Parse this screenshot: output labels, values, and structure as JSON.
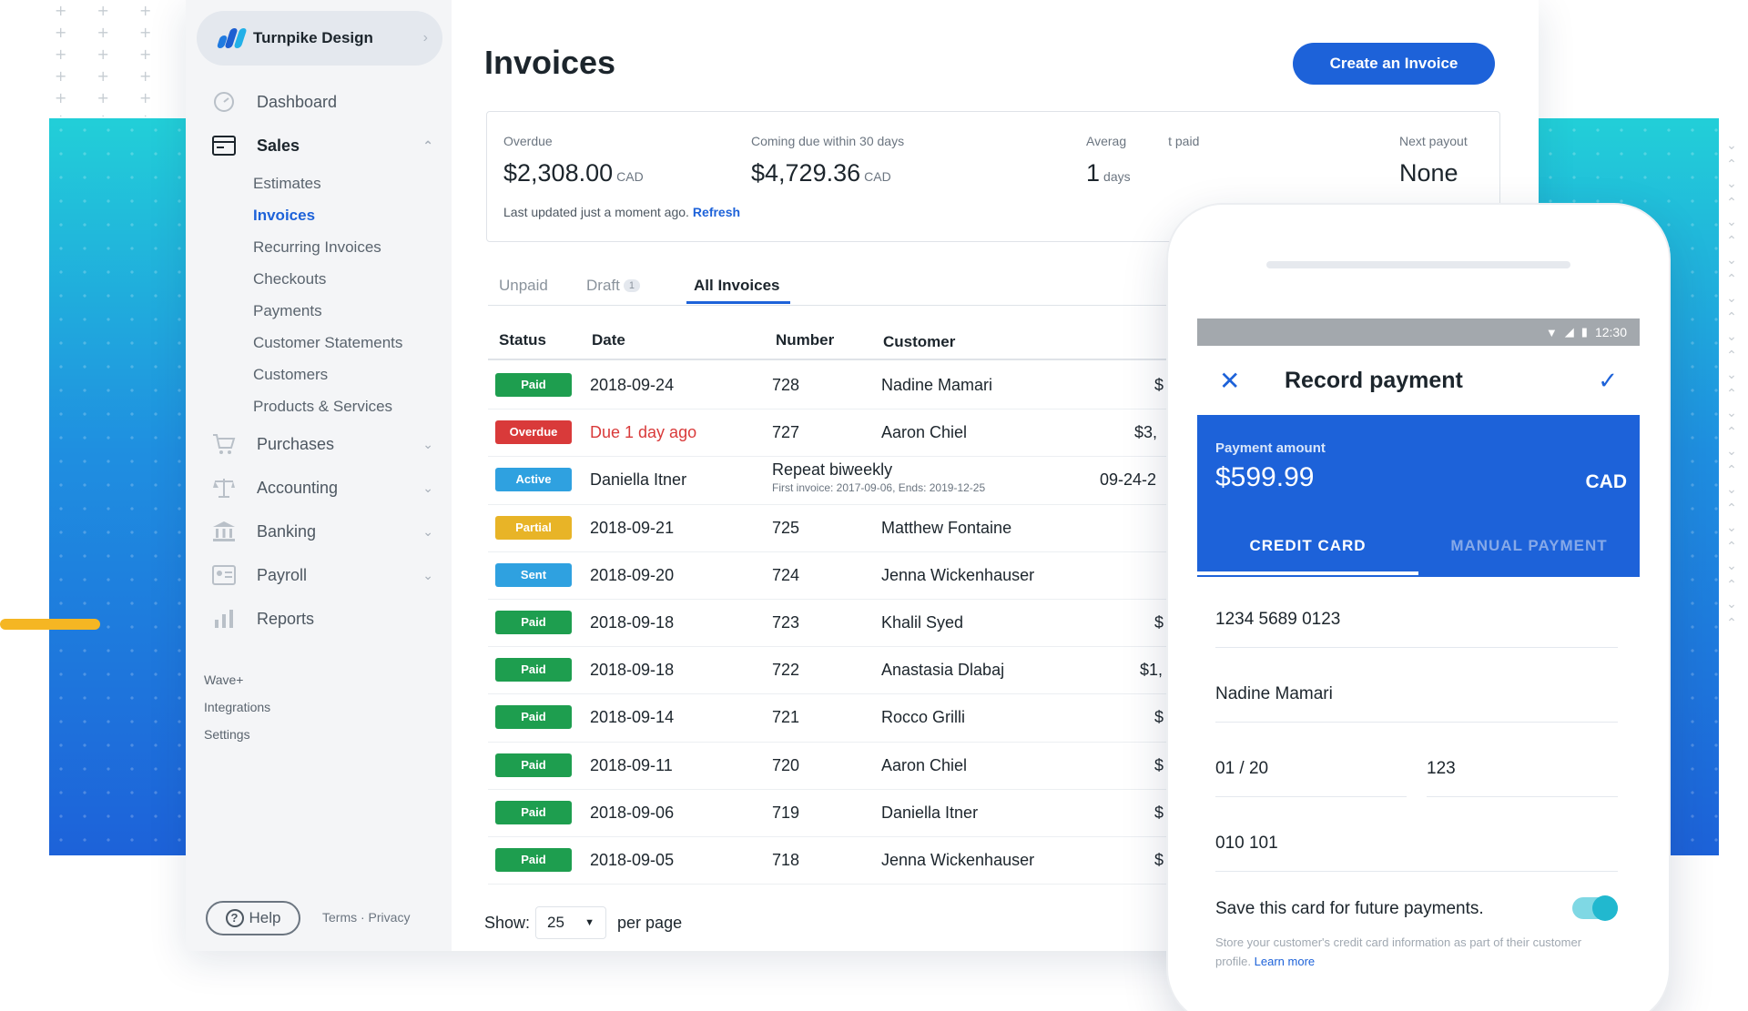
{
  "brand": {
    "name": "Turnpike Design"
  },
  "nav": [
    {
      "label": "Dashboard"
    },
    {
      "label": "Sales"
    },
    {
      "label": "Purchases"
    },
    {
      "label": "Accounting"
    },
    {
      "label": "Banking"
    },
    {
      "label": "Payroll"
    },
    {
      "label": "Reports"
    }
  ],
  "sales_sub": [
    {
      "label": "Estimates"
    },
    {
      "label": "Invoices"
    },
    {
      "label": "Recurring Invoices"
    },
    {
      "label": "Checkouts"
    },
    {
      "label": "Payments"
    },
    {
      "label": "Customer Statements"
    },
    {
      "label": "Customers"
    },
    {
      "label": "Products & Services"
    }
  ],
  "extra_links": [
    "Wave+",
    "Integrations",
    "Settings"
  ],
  "footer": {
    "help": "Help",
    "terms": "Terms · Privacy"
  },
  "page": {
    "title": "Invoices",
    "create_label": "Create an Invoice"
  },
  "summary": {
    "overdue_label": "Overdue",
    "overdue_value": "$2,308.00",
    "overdue_cur": "CAD",
    "coming_label": "Coming due within 30 days",
    "coming_value": "$4,729.36",
    "coming_cur": "CAD",
    "avg_label": "Averag",
    "avg_value": "1",
    "avg_unit": "days",
    "paid_label": "t paid",
    "next_label": "Next payout",
    "next_value": "None",
    "updated": "Last updated just a moment ago.",
    "refresh": "Refresh"
  },
  "tabs": {
    "unpaid": "Unpaid",
    "draft": "Draft",
    "draft_count": "1",
    "all": "All Invoices"
  },
  "columns": {
    "status": "Status",
    "date": "Date",
    "number": "Number",
    "customer": "Customer"
  },
  "rows": [
    {
      "status": "Paid",
      "color": "#1e9e4f",
      "date": "2018-09-24",
      "number": "728",
      "customer": "Nadine Mamari",
      "amount": "$"
    },
    {
      "status": "Overdue",
      "color": "#d93a3a",
      "date": "Due 1 day ago",
      "number": "727",
      "customer": "Aaron Chiel",
      "amount": "$3,",
      "due": true
    },
    {
      "status": "Active",
      "color": "#2fa1e0",
      "date": "Daniella Itner",
      "number": "Repeat biweekly",
      "number_sub": "First invoice: 2017-09-06, Ends: 2019-12-25",
      "customer": "",
      "amount": "09-24-2"
    },
    {
      "status": "Partial",
      "color": "#e8b427",
      "date": "2018-09-21",
      "number": "725",
      "customer": "Matthew Fontaine",
      "amount": ""
    },
    {
      "status": "Sent",
      "color": "#2fa1e0",
      "date": "2018-09-20",
      "number": "724",
      "customer": "Jenna Wickenhauser",
      "amount": ""
    },
    {
      "status": "Paid",
      "color": "#1e9e4f",
      "date": "2018-09-18",
      "number": "723",
      "customer": "Khalil Syed",
      "amount": "$"
    },
    {
      "status": "Paid",
      "color": "#1e9e4f",
      "date": "2018-09-18",
      "number": "722",
      "customer": "Anastasia Dlabaj",
      "amount": "$1,"
    },
    {
      "status": "Paid",
      "color": "#1e9e4f",
      "date": "2018-09-14",
      "number": "721",
      "customer": "Rocco Grilli",
      "amount": "$"
    },
    {
      "status": "Paid",
      "color": "#1e9e4f",
      "date": "2018-09-11",
      "number": "720",
      "customer": "Aaron Chiel",
      "amount": "$"
    },
    {
      "status": "Paid",
      "color": "#1e9e4f",
      "date": "2018-09-06",
      "number": "719",
      "customer": "Daniella Itner",
      "amount": "$"
    },
    {
      "status": "Paid",
      "color": "#1e9e4f",
      "date": "2018-09-05",
      "number": "718",
      "customer": "Jenna Wickenhauser",
      "amount": "$"
    }
  ],
  "pager": {
    "show": "Show:",
    "value": "25",
    "per_page": "per page"
  },
  "phone": {
    "time": "12:30",
    "title": "Record payment",
    "amount_label": "Payment amount",
    "amount_value": "$599.99",
    "currency": "CAD",
    "tab_card": "CREDIT CARD",
    "tab_manual": "MANUAL PAYMENT",
    "card_number": "1234 5689 0123",
    "card_name": "Nadine Mamari",
    "expiry": "01 / 20",
    "cvv": "123",
    "postal": "010 101",
    "save_label": "Save this card for future payments.",
    "save_help": "Store your customer's credit card information as part of their customer profile.",
    "learn_more": "Learn more"
  },
  "colors": {
    "primary": "#1d62d9",
    "paid": "#1e9e4f",
    "overdue": "#d93a3a",
    "active": "#2fa1e0",
    "partial": "#e8b427",
    "toggle": "#21b8cf"
  }
}
